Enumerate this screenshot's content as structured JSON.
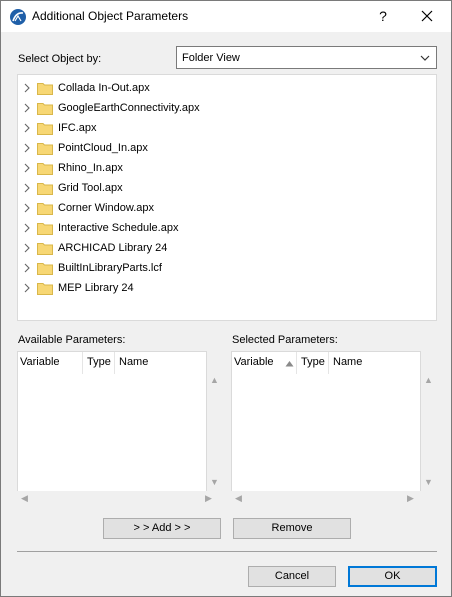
{
  "window": {
    "title": "Additional Object Parameters",
    "help_label": "?"
  },
  "selector": {
    "label": "Select Object by:",
    "value": "Folder View"
  },
  "tree": {
    "items": [
      {
        "label": "Collada In-Out.apx"
      },
      {
        "label": "GoogleEarthConnectivity.apx"
      },
      {
        "label": "IFC.apx"
      },
      {
        "label": "PointCloud_In.apx"
      },
      {
        "label": "Rhino_In.apx"
      },
      {
        "label": "Grid Tool.apx"
      },
      {
        "label": "Corner Window.apx"
      },
      {
        "label": "Interactive Schedule.apx"
      },
      {
        "label": "ARCHICAD Library 24"
      },
      {
        "label": "BuiltInLibraryParts.lcf"
      },
      {
        "label": "MEP Library 24"
      }
    ]
  },
  "available": {
    "label": "Available Parameters:",
    "columns": [
      "Variable",
      "Type",
      "Name"
    ]
  },
  "selected": {
    "label": "Selected Parameters:",
    "columns": [
      "Variable",
      "Type",
      "Name"
    ]
  },
  "buttons": {
    "add": "> > Add > >",
    "remove": "Remove",
    "cancel": "Cancel",
    "ok": "OK"
  },
  "colors": {
    "accent": "#0078d7",
    "folder": "#f7d774",
    "app_icon": "#1f5fa8"
  }
}
